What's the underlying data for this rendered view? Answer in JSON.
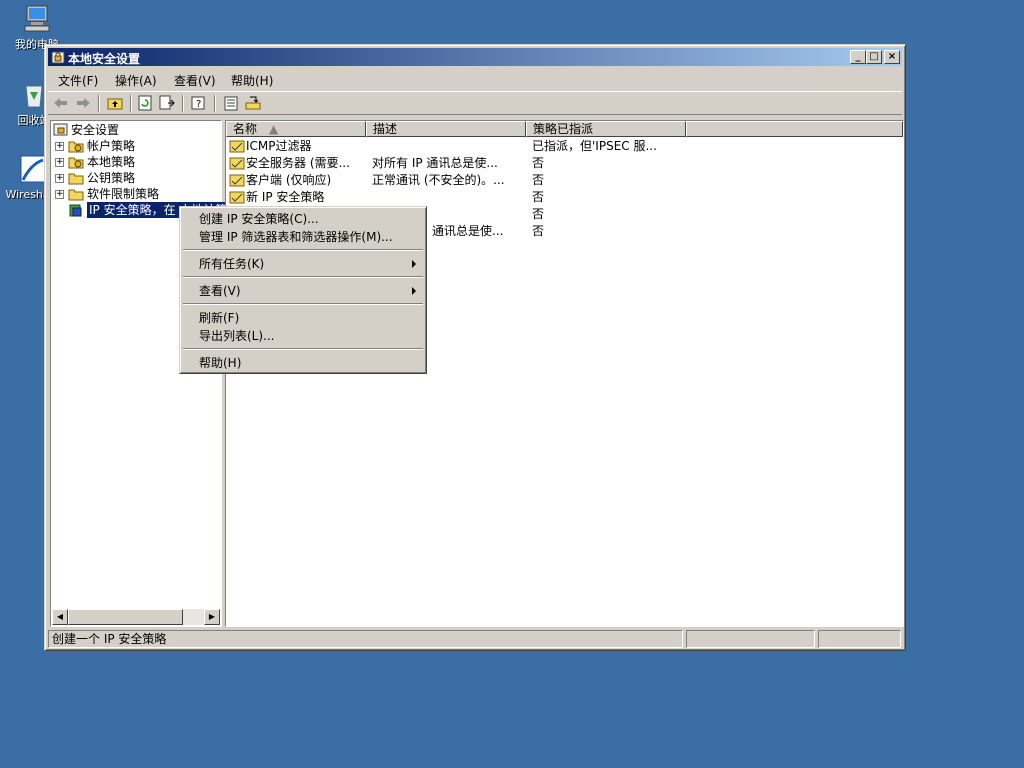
{
  "desktop": {
    "icons": [
      {
        "label": "我的电脑",
        "icon": "my-computer-icon"
      },
      {
        "label": "回收站",
        "icon": "recycle-bin-icon"
      },
      {
        "label": "Wireshark",
        "icon": "wireshark-icon"
      }
    ]
  },
  "window": {
    "title": "本地安全设置",
    "buttons": {
      "minimize": "_",
      "maximize": "□",
      "close": "×"
    }
  },
  "menubar": {
    "items": [
      "文件(F)",
      "操作(A)",
      "查看(V)",
      "帮助(H)"
    ]
  },
  "toolbar": {
    "tools": [
      "back-arrow-icon",
      "forward-arrow-icon",
      "up-folder-icon",
      "refresh-icon",
      "export-list-icon",
      "help-icon",
      "properties-icon",
      "assign-icon"
    ]
  },
  "tree": {
    "root": "安全设置",
    "items": [
      "帐户策略",
      "本地策略",
      "公钥策略",
      "软件限制策略",
      "IP 安全策略，在 本地计算机"
    ]
  },
  "list": {
    "columns": [
      "名称",
      "描述",
      "策略已指派"
    ],
    "rows": [
      {
        "name": "ICMP过滤器",
        "desc": "",
        "assigned": "已指派，但'IPSEC 服..."
      },
      {
        "name": "安全服务器 (需要...",
        "desc": "对所有 IP 通讯总是使...",
        "assigned": "否"
      },
      {
        "name": "客户端 (仅响应)",
        "desc": "正常通讯 (不安全的)。...",
        "assigned": "否"
      },
      {
        "name": "新 IP 安全策略",
        "desc": "",
        "assigned": "否"
      },
      {
        "name": "",
        "desc": "",
        "assigned": "否"
      },
      {
        "name": "",
        "desc": "通讯总是使...",
        "assigned": "否"
      }
    ]
  },
  "context_menu": {
    "items": [
      {
        "label": "创建 IP 安全策略(C)...",
        "submenu": false
      },
      {
        "label": "管理 IP 筛选器表和筛选器操作(M)...",
        "submenu": false
      },
      {
        "label": "所有任务(K)",
        "submenu": true
      },
      {
        "label": "查看(V)",
        "submenu": true
      },
      {
        "label": "刷新(F)",
        "submenu": false
      },
      {
        "label": "导出列表(L)...",
        "submenu": false
      },
      {
        "label": "帮助(H)",
        "submenu": false
      }
    ]
  },
  "statusbar": {
    "text": "创建一个 IP 安全策略"
  },
  "colors": {
    "desktop": "#3a6ea5",
    "title_start": "#0a246a",
    "title_end": "#a6caf0",
    "selection": "#0a246a",
    "face": "#d4d0c8"
  }
}
